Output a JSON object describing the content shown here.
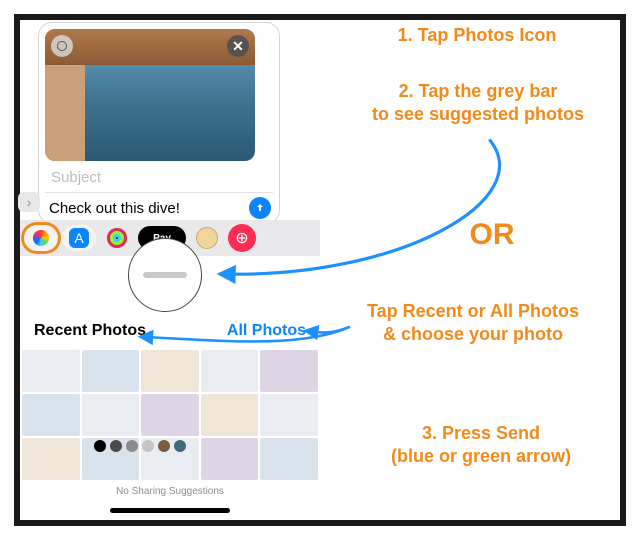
{
  "compose": {
    "subject_placeholder": "Subject",
    "message_text": "Check out this dive!",
    "close_icon": "✕",
    "live_icon": "live-photo-icon"
  },
  "drawer": {
    "apps": [
      {
        "name": "photos-app-icon"
      },
      {
        "name": "appstore-app-icon",
        "glyph": "A"
      },
      {
        "name": "activity-app-icon"
      },
      {
        "name": "applepay-app-icon",
        "label": " Pay"
      },
      {
        "name": "animoji-app-icon"
      },
      {
        "name": "more-app-icon",
        "glyph": "⊕"
      }
    ]
  },
  "tabs": {
    "recent_label": "Recent Photos",
    "all_label": "All Photos"
  },
  "sharing_suggestions": "No Sharing Suggestions",
  "annotations": {
    "step1": "1. Tap Photos Icon",
    "step2": "2. Tap the grey bar\nto see suggested photos",
    "or": "OR",
    "step3": "Tap Recent or All Photos\n& choose your photo",
    "step4": "3. Press Send\n(blue or green arrow)"
  },
  "colors": {
    "accent": "#f18a1b",
    "ios_blue": "#0a84ff"
  }
}
